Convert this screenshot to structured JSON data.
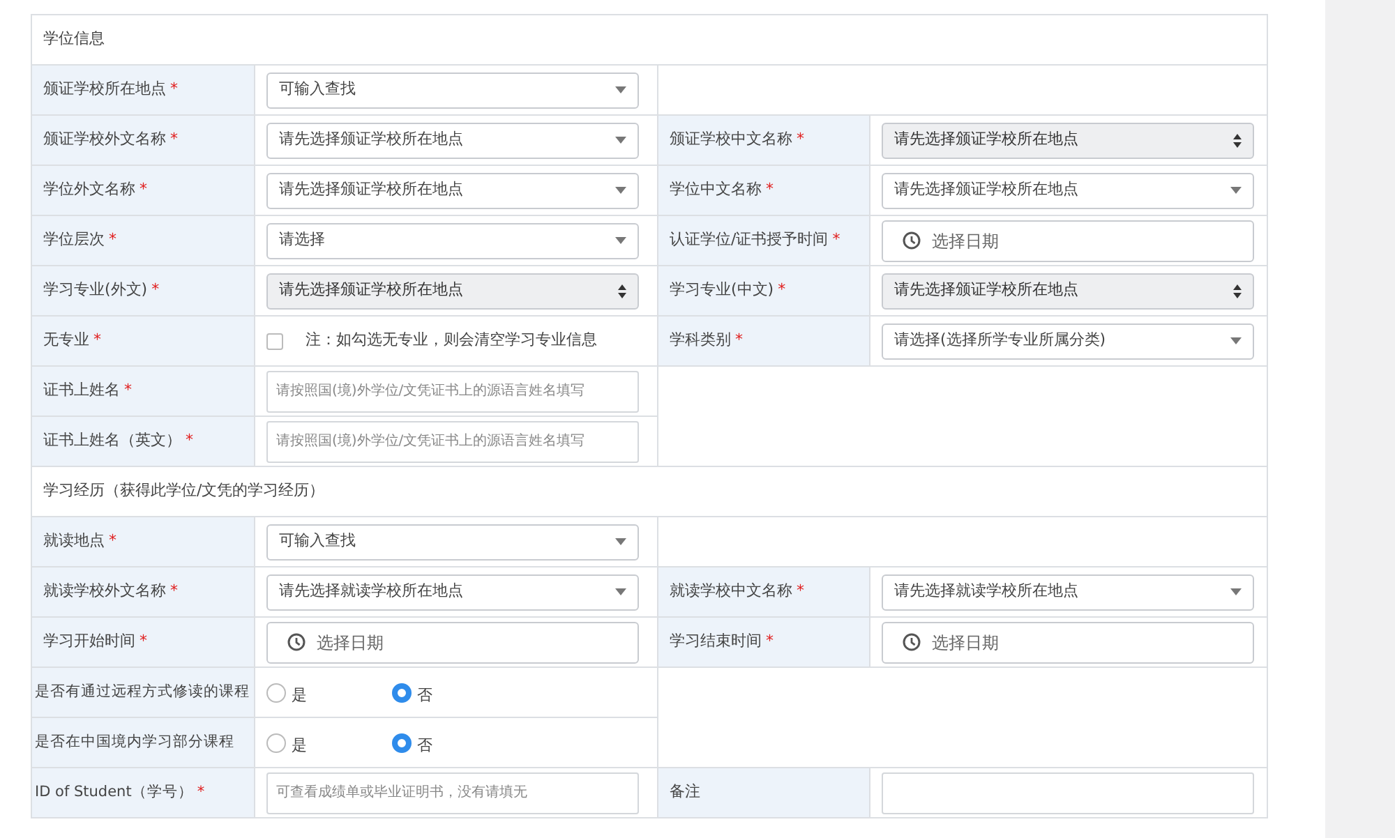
{
  "sections": [
    {
      "title": "学位信息",
      "rows": [
        [
          {
            "label": "颁证学校所在地点",
            "mark": "*",
            "control": {
              "kind": "select",
              "text": "可输入查找",
              "disabled": false
            }
          }
        ],
        [
          {
            "label": "颁证学校外文名称",
            "mark": "*",
            "control": {
              "kind": "select",
              "text": "请先选择颁证学校所在地点",
              "disabled": false
            }
          },
          {
            "label": "颁证学校中文名称",
            "mark": "*",
            "control": {
              "kind": "select",
              "text": "请先选择颁证学校所在地点",
              "disabled": true
            }
          }
        ],
        [
          {
            "label": "学位外文名称",
            "mark": "*",
            "control": {
              "kind": "select",
              "text": "请先选择颁证学校所在地点",
              "disabled": false
            }
          },
          {
            "label": "学位中文名称",
            "mark": "*",
            "control": {
              "kind": "select",
              "text": "请先选择颁证学校所在地点",
              "disabled": false
            }
          }
        ],
        [
          {
            "label": "学位层次",
            "mark": "*",
            "control": {
              "kind": "select",
              "text": "请选择",
              "disabled": false
            }
          },
          {
            "label": "认证学位/证书授予时间",
            "mark": "*",
            "control": {
              "kind": "date",
              "placeholder": "选择日期"
            }
          }
        ],
        [
          {
            "label": "学习专业(外文)",
            "mark": "*",
            "control": {
              "kind": "select",
              "text": "请先选择颁证学校所在地点",
              "disabled": true
            }
          },
          {
            "label": "学习专业(中文)",
            "mark": "*",
            "control": {
              "kind": "select",
              "text": "请先选择颁证学校所在地点",
              "disabled": true
            }
          }
        ],
        [
          {
            "label": "无专业",
            "mark": "*",
            "control": {
              "kind": "checkbox",
              "checked": false,
              "note": "注：如勾选无专业，则会清空学习专业信息"
            }
          },
          {
            "label": "学科类别",
            "mark": "*",
            "control": {
              "kind": "select",
              "text": "请选择(选择所学专业所属分类)",
              "disabled": false
            }
          }
        ],
        [
          {
            "label": "证书上姓名",
            "mark": "*",
            "control": {
              "kind": "text",
              "placeholder": "请按照国(境)外学位/文凭证书上的源语言姓名填写"
            }
          }
        ],
        [
          {
            "label": "证书上姓名（英文）",
            "mark": "*",
            "control": {
              "kind": "text",
              "placeholder": "请按照国(境)外学位/文凭证书上的源语言姓名填写"
            }
          }
        ]
      ]
    },
    {
      "title": "学习经历（获得此学位/文凭的学习经历）",
      "rows": [
        [
          {
            "label": "就读地点",
            "mark": "*",
            "control": {
              "kind": "select",
              "text": "可输入查找",
              "disabled": false
            }
          }
        ],
        [
          {
            "label": "就读学校外文名称",
            "mark": "*",
            "control": {
              "kind": "select",
              "text": "请先选择就读学校所在地点",
              "disabled": false
            }
          },
          {
            "label": "就读学校中文名称",
            "mark": "*",
            "control": {
              "kind": "select",
              "text": "请先选择就读学校所在地点",
              "disabled": false
            }
          }
        ],
        [
          {
            "label": "学习开始时间",
            "mark": "*",
            "control": {
              "kind": "date",
              "placeholder": "选择日期"
            }
          },
          {
            "label": "学习结束时间",
            "mark": "*",
            "control": {
              "kind": "date",
              "placeholder": "选择日期"
            }
          }
        ],
        [
          {
            "label": "是否有通过远程方式修读的课程",
            "control": {
              "kind": "radio",
              "options": [
                {
                  "label": "是",
                  "selected": false
                },
                {
                  "label": "否",
                  "selected": true
                }
              ]
            }
          }
        ],
        [
          {
            "label": "是否在中国境内学习部分课程",
            "control": {
              "kind": "radio",
              "options": [
                {
                  "label": "是",
                  "selected": false
                },
                {
                  "label": "否",
                  "selected": true
                }
              ]
            }
          }
        ],
        [
          {
            "label": "ID of Student（学号）",
            "mark": "*",
            "control": {
              "kind": "text",
              "placeholder": "可查看成绩单或毕业证明书，没有请填无"
            }
          },
          {
            "label": "备注",
            "control": {
              "kind": "text"
            }
          }
        ]
      ]
    }
  ]
}
